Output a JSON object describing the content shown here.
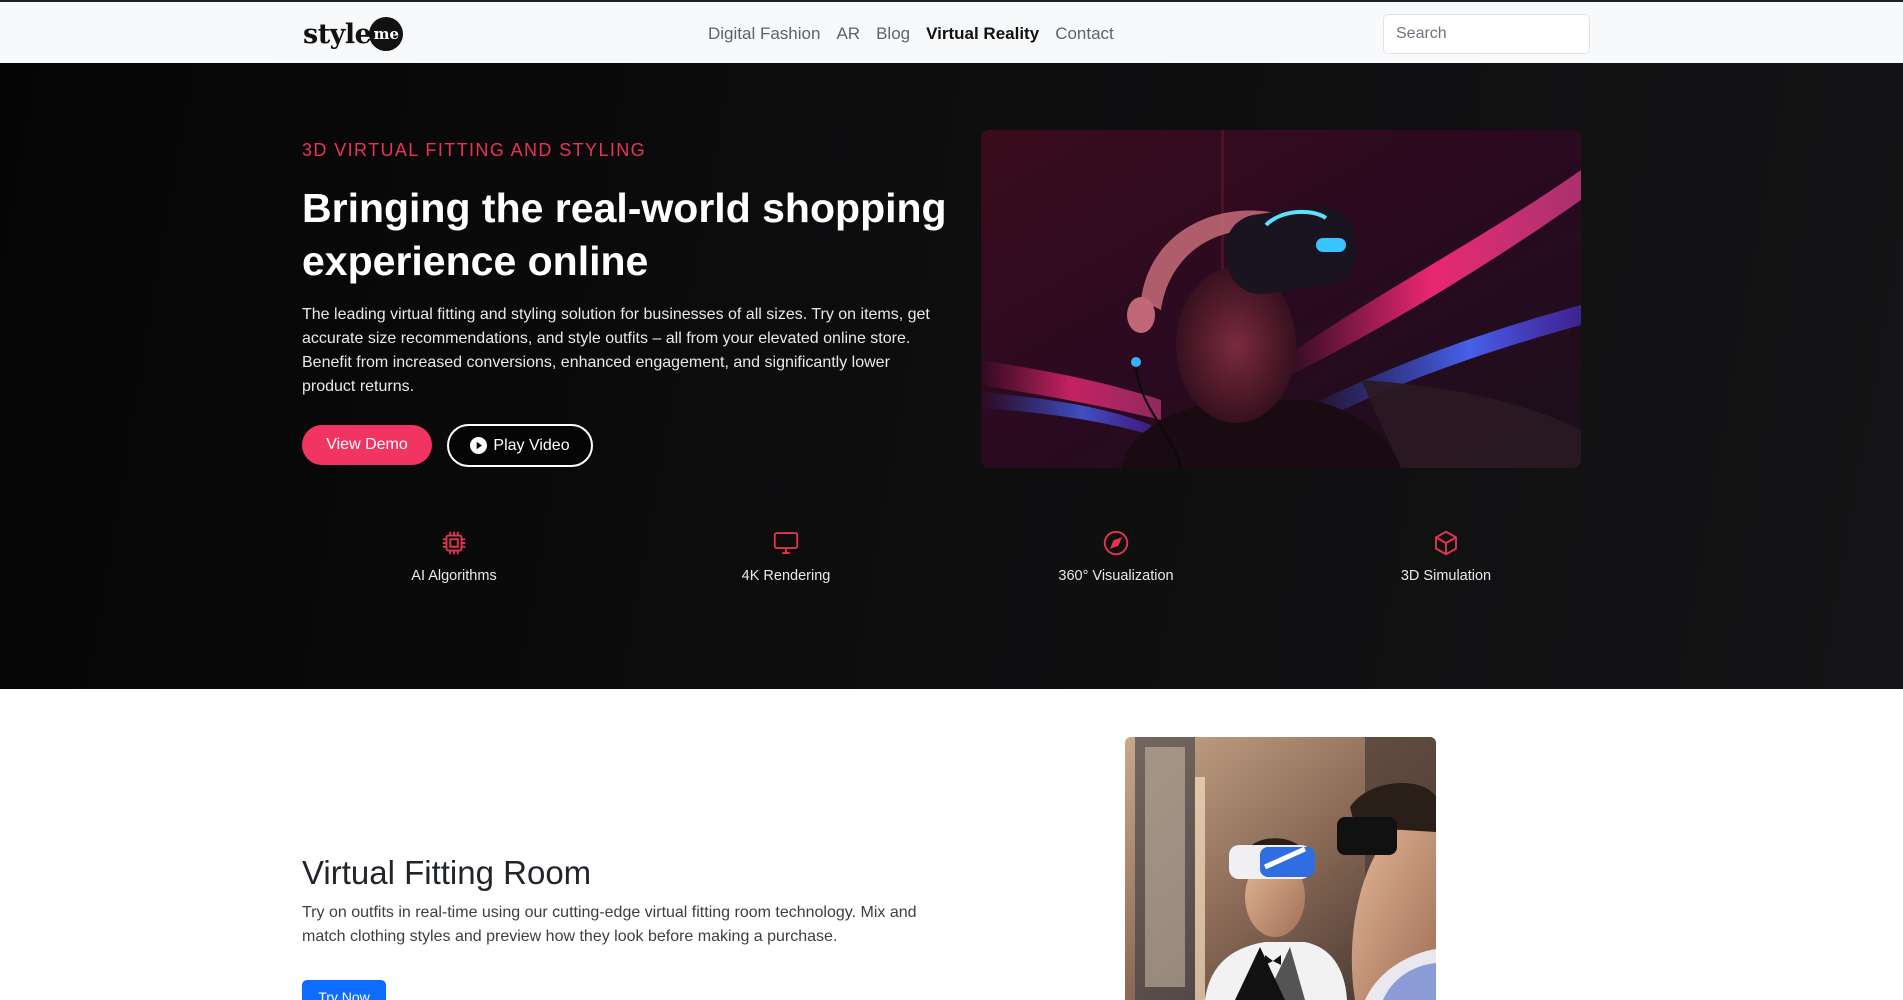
{
  "nav": {
    "logo_text": "style",
    "logo_badge": "me",
    "links": [
      {
        "label": "Digital Fashion",
        "active": false
      },
      {
        "label": "AR",
        "active": false
      },
      {
        "label": "Blog",
        "active": false
      },
      {
        "label": "Virtual Reality",
        "active": true
      },
      {
        "label": "Contact",
        "active": false
      }
    ],
    "search_placeholder": "Search"
  },
  "hero": {
    "eyebrow": "3D VIRTUAL FITTING AND STYLING",
    "title": "Bringing the real-world shopping experience online",
    "description": "The leading virtual fitting and styling solution for businesses of all sizes. Try on items, get accurate size recommendations, and style outfits – all from your elevated online store. Benefit from increased conversions, enhanced engagement, and significantly lower product returns.",
    "demo_button": "View Demo",
    "video_button": "Play Video"
  },
  "features": [
    {
      "icon": "cpu-icon",
      "label": "AI Algorithms"
    },
    {
      "icon": "monitor-icon",
      "label": "4K Rendering"
    },
    {
      "icon": "compass-icon",
      "label": "360° Visualization"
    },
    {
      "icon": "cube-icon",
      "label": "3D Simulation"
    }
  ],
  "fitting_room": {
    "title": "Virtual Fitting Room",
    "description": "Try on outfits in real-time using our cutting-edge virtual fitting room technology. Mix and match clothing styles and preview how they look before making a purchase.",
    "button": "Try Now"
  },
  "colors": {
    "accent": "#f23462",
    "eyebrow": "#e8345a",
    "primary_button": "#0d6efd",
    "hero_bg": "#0a0a0b"
  }
}
